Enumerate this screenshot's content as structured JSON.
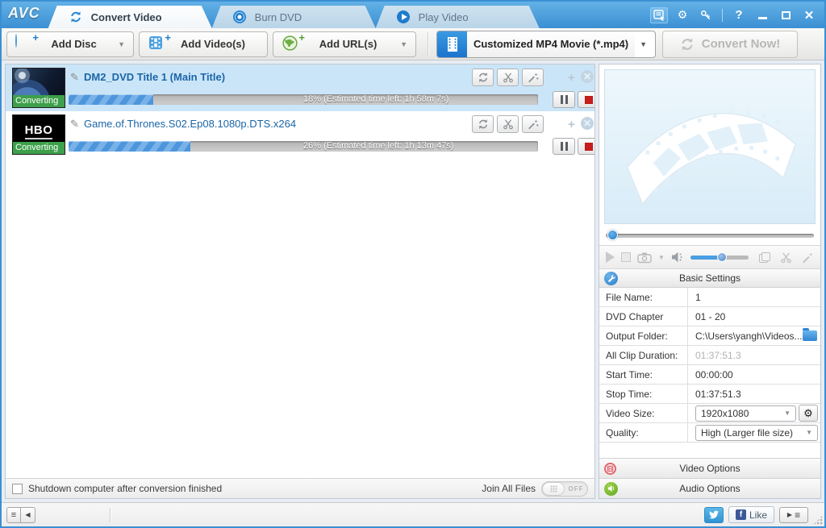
{
  "window": {
    "logo": "AVC",
    "tabs": [
      {
        "label": "Convert Video"
      },
      {
        "label": "Burn DVD"
      },
      {
        "label": "Play Video"
      }
    ],
    "help": "?"
  },
  "toolbar": {
    "add_disc": "Add Disc",
    "add_videos": "Add Video(s)",
    "add_urls": "Add URL(s)",
    "output_format": "Customized MP4 Movie (*.mp4)",
    "convert_now": "Convert Now!"
  },
  "queue": {
    "items": [
      {
        "title": "DM2_DVD Title 1 (Main Title)",
        "status": "Converting",
        "progress": 18,
        "progress_text": "18% (Estimated time left: 1h 58m 7s)"
      },
      {
        "title": "Game.of.Thrones.S02.Ep08.1080p.DTS.x264",
        "status": "Converting",
        "progress": 26,
        "progress_text": "26% (Estimated time left: 1h 13m 47s)",
        "thumb_label": "HBO"
      }
    ]
  },
  "options_bar": {
    "shutdown_label": "Shutdown computer after conversion finished",
    "join_label": "Join All Files",
    "join_state": "OFF"
  },
  "settings": {
    "header": "Basic Settings",
    "file_name": {
      "label": "File Name:",
      "value": "1"
    },
    "dvd_chapter": {
      "label": "DVD Chapter",
      "value": "01 - 20"
    },
    "output_folder": {
      "label": "Output Folder:",
      "value": "C:\\Users\\yangh\\Videos..."
    },
    "all_clip_duration": {
      "label": "All Clip Duration:",
      "value": "01:37:51.3"
    },
    "start_time": {
      "label": "Start Time:",
      "value": "00:00:00"
    },
    "stop_time": {
      "label": "Stop Time:",
      "value": "01:37:51.3"
    },
    "video_size": {
      "label": "Video Size:",
      "value": "1920x1080"
    },
    "quality": {
      "label": "Quality:",
      "value": "High (Larger file size)"
    },
    "video_options": "Video Options",
    "audio_options": "Audio Options"
  },
  "statusbar": {
    "like_label": "Like"
  }
}
